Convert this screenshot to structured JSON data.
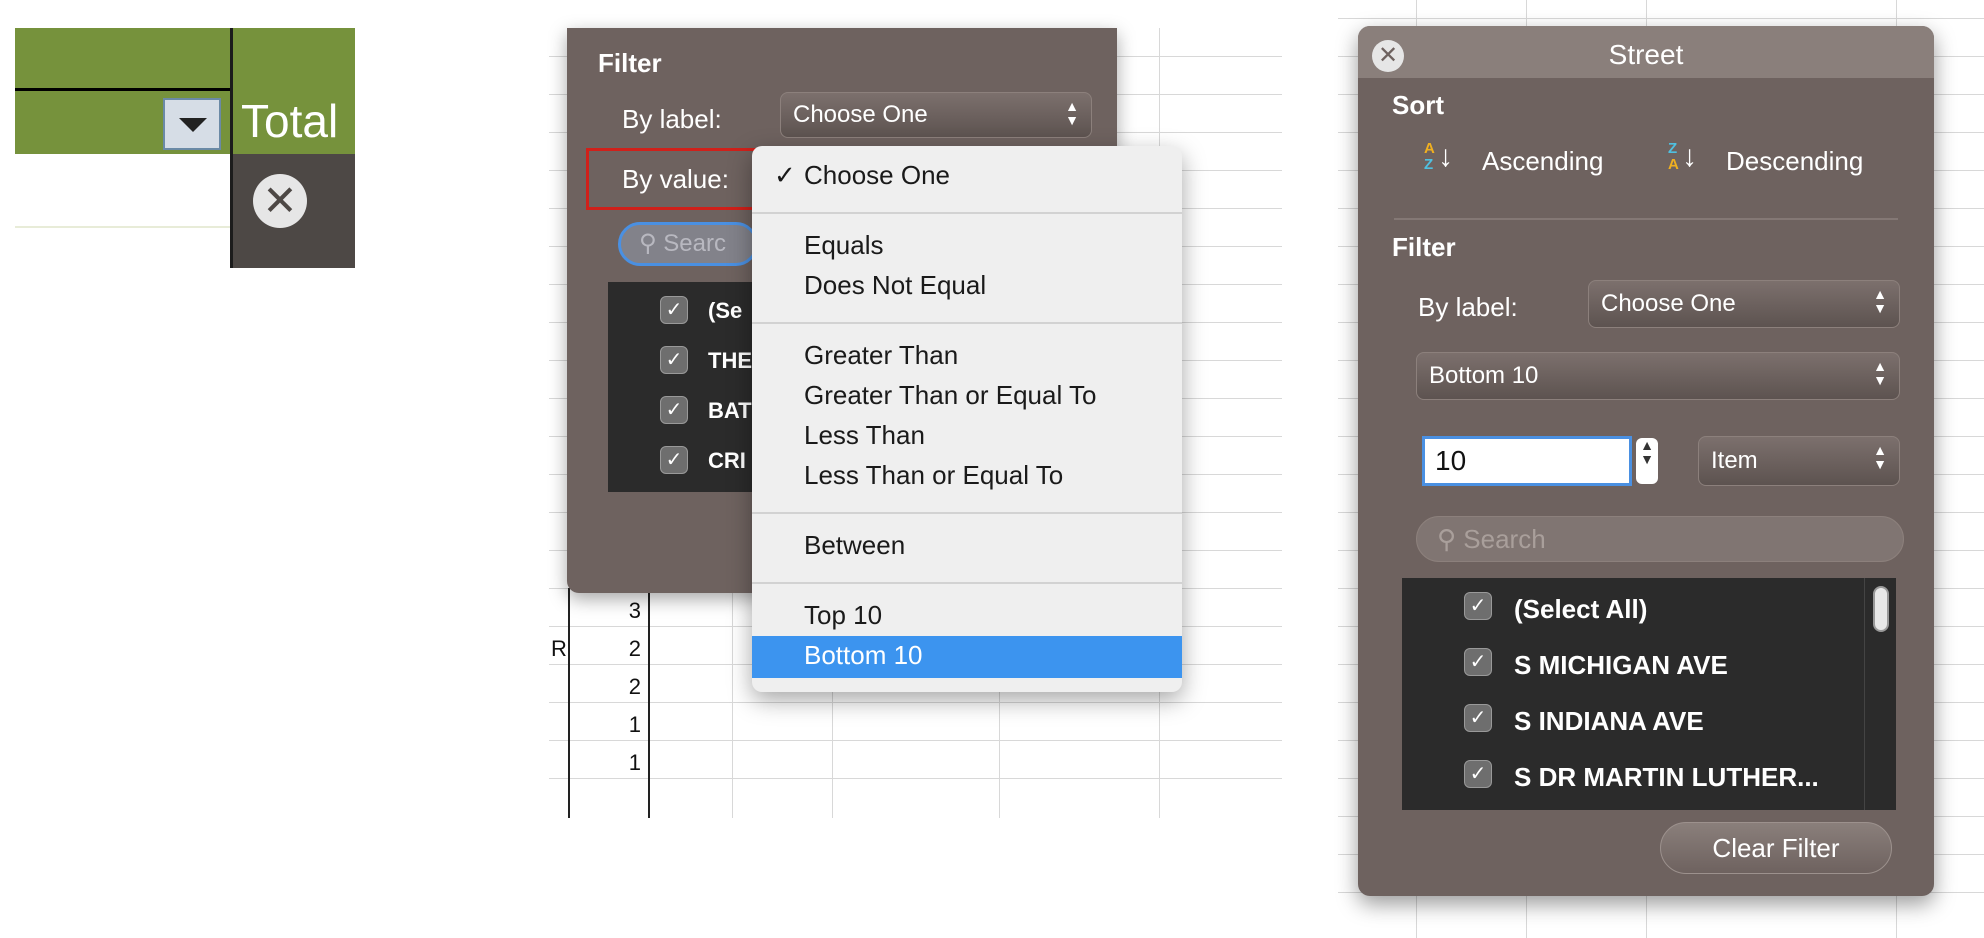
{
  "panel1": {
    "header_text": "Total"
  },
  "panel2": {
    "filter_heading": "Filter",
    "by_label": "By label:",
    "by_label_value": "Choose One",
    "by_value": "By value:",
    "search_placeholder": "Searc",
    "list_items": [
      "(Se",
      "THE",
      "BAT",
      "CRI"
    ],
    "sheet_numbers": [
      "3",
      "2",
      "2",
      "1",
      "1"
    ],
    "sheet_fragment": "R",
    "dropdown": {
      "checked": "Choose One",
      "group2": [
        "Equals",
        "Does Not Equal"
      ],
      "group3": [
        "Greater Than",
        "Greater Than or Equal To",
        "Less Than",
        "Less Than or Equal To"
      ],
      "group4": [
        "Between"
      ],
      "group5": [
        "Top 10",
        "Bottom 10"
      ],
      "selected": "Bottom 10",
      "selected_color": "#3c94ef"
    }
  },
  "panel3": {
    "title": "Street",
    "sort_heading": "Sort",
    "ascending": "Ascending",
    "descending": "Descending",
    "filter_heading": "Filter",
    "by_label": "By label:",
    "by_label_value": "Choose One",
    "condition_value": "Bottom 10",
    "count_value": "10",
    "unit_value": "Item",
    "search_placeholder": "Search",
    "list_items": [
      "(Select All)",
      "S MICHIGAN AVE",
      "S INDIANA AVE",
      "S DR MARTIN LUTHER..."
    ],
    "clear_button": "Clear Filter"
  },
  "colors": {
    "header_green": "#76923c",
    "panel_brown": "#6e625f",
    "highlight_red": "#d0201a",
    "focus_blue": "#4a90e2"
  }
}
